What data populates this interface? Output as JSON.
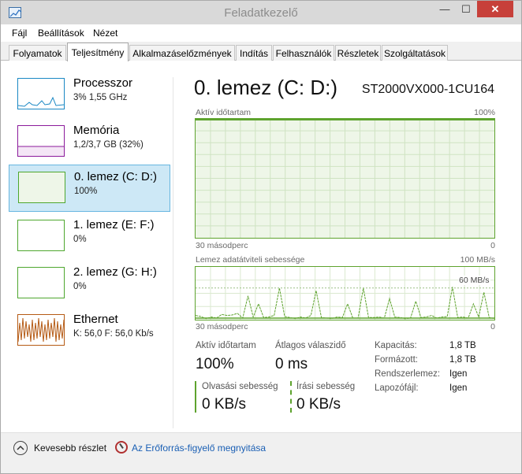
{
  "window": {
    "title": "Feladatkezelő",
    "minimize": "—",
    "maximize": "☐",
    "close": "✕"
  },
  "menu": [
    "Fájl",
    "Beállítások",
    "Nézet"
  ],
  "tabs": [
    "Folyamatok",
    "Teljesítmény",
    "Alkalmazáselőzmények",
    "Indítás",
    "Felhasználók",
    "Részletek",
    "Szolgáltatások"
  ],
  "sidebar": {
    "items": [
      {
        "title": "Processzor",
        "sub": "3% 1,55 GHz",
        "color": "#1a88c4"
      },
      {
        "title": "Memória",
        "sub": "1,2/3,7 GB (32%)",
        "color": "#8b1a9b"
      },
      {
        "title": "0. lemez (C: D:)",
        "sub": "100%",
        "color": "#4ea72e"
      },
      {
        "title": "1. lemez (E: F:)",
        "sub": "0%",
        "color": "#4ea72e"
      },
      {
        "title": "2. lemez (G: H:)",
        "sub": "0%",
        "color": "#4ea72e"
      },
      {
        "title": "Ethernet",
        "sub": "K: 56,0  F: 56,0 Kb/s",
        "color": "#b55a14"
      }
    ]
  },
  "main": {
    "title": "0. lemez (C: D:)",
    "model": "ST2000VX000-1CU164",
    "graph1": {
      "label": "Aktív időtartam",
      "max": "100%",
      "x_left": "30 másodperc",
      "x_right": "0",
      "level": 1.0
    },
    "graph2": {
      "label": "Lemez adatátviteli sebessége",
      "max": "100 MB/s",
      "mid": "60 MB/s",
      "x_left": "30 másodperc",
      "x_right": "0",
      "series": [
        8,
        6,
        2,
        5,
        3,
        10,
        8,
        9,
        12,
        3,
        45,
        5,
        30,
        4,
        5,
        8,
        60,
        6,
        4,
        2,
        5,
        3,
        8,
        55,
        4,
        3,
        2,
        5,
        4,
        30,
        3,
        3,
        60,
        4,
        4,
        5,
        3,
        40,
        5,
        4,
        2,
        3,
        35,
        4,
        5,
        8,
        3,
        5,
        6,
        62,
        4,
        5,
        3,
        30,
        5,
        52,
        4,
        2
      ]
    },
    "stats": {
      "active_label": "Aktív időtartam",
      "active_value": "100%",
      "avg_label": "Átlagos válaszidő",
      "avg_value": "0 ms",
      "read_label": "Olvasási sebesség",
      "read_value": "0 KB/s",
      "write_label": "Írási sebesség",
      "write_value": "0 KB/s"
    },
    "details": [
      {
        "key": "Kapacitás:",
        "val": "1,8 TB"
      },
      {
        "key": "Formázott:",
        "val": "1,8 TB"
      },
      {
        "key": "Rendszerlemez:",
        "val": "Igen"
      },
      {
        "key": "Lapozófájl:",
        "val": "Igen"
      }
    ]
  },
  "footer": {
    "fewer": "Kevesebb részlet",
    "open_monitor": "Az Erőforrás-figyelő megnyitása"
  },
  "colors": {
    "accent_green": "#5ea32e",
    "link": "#1a5fb4",
    "selection": "#cde8f6"
  }
}
